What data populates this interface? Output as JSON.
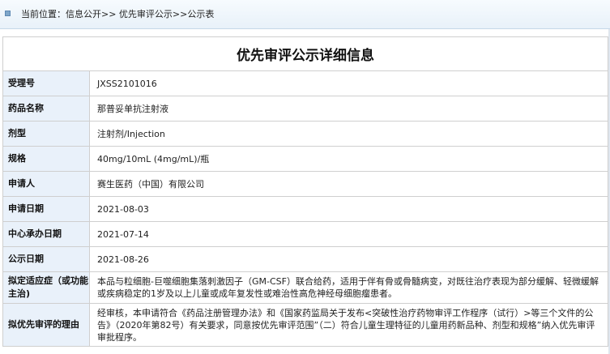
{
  "breadcrumb": {
    "text": "当前位置：信息公开>> 优先审评公示>>公示表"
  },
  "page_title": "优先审评公示详细信息",
  "rows": [
    {
      "label": "受理号",
      "value": "JXSS2101016"
    },
    {
      "label": "药品名称",
      "value": "那普妥单抗注射液"
    },
    {
      "label": "剂型",
      "value": "注射剂/Injection"
    },
    {
      "label": "规格",
      "value": "40mg/10mL (4mg/mL)/瓶"
    },
    {
      "label": "申请人",
      "value": "赛生医药（中国）有限公司"
    },
    {
      "label": "申请日期",
      "value": "2021-08-03"
    },
    {
      "label": "中心承办日期",
      "value": "2021-07-14"
    },
    {
      "label": "公示日期",
      "value": "2021-08-26"
    },
    {
      "label": "拟定适应症（或功能主治)",
      "value": "本品与粒细胞-巨噬细胞集落刺激因子（GM-CSF）联合给药，适用于伴有骨或骨髓病变，对既往治疗表现为部分缓解、轻微缓解或疾病稳定的1岁及以上儿童或成年复发性或难治性高危神经母细胞瘤患者。"
    },
    {
      "label": "拟优先审评的理由",
      "value": "经审核，本申请符合《药品注册管理办法》和《国家药监局关于发布<突破性治疗药物审评工作程序（试行）>等三个文件的公告》（2020年第82号）有关要求，同意按优先审评范围”（二）符合儿童生理特征的儿童用药新品种、剂型和规格”纳入优先审评审批程序。"
    }
  ],
  "colors": {
    "label_bg": "#e9f1fa",
    "border": "#cfcfcf",
    "crumb_bg": "#e8f1f9"
  }
}
